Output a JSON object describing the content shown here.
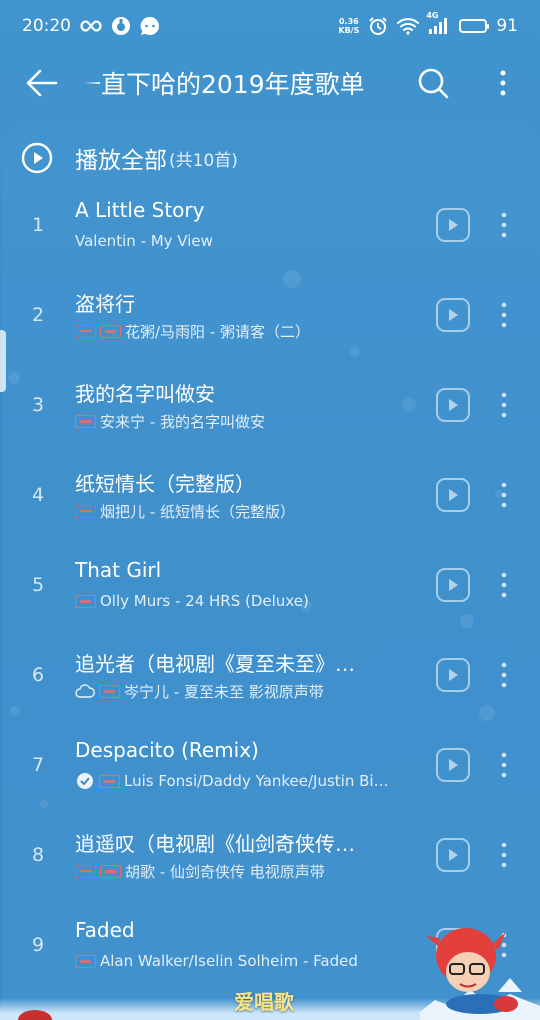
{
  "status_bar": {
    "time": "20:20",
    "net_speed_value": "0.36",
    "net_speed_unit": "KB/S",
    "network_type": "4G",
    "battery": "91"
  },
  "app_bar": {
    "title": "一直下哈的2019年度歌单"
  },
  "play_all": {
    "label": "播放全部",
    "count": "(共10首)"
  },
  "songs": [
    {
      "index": "1",
      "title": "A Little Story",
      "artist": "Valentin - My View",
      "tags": []
    },
    {
      "index": "2",
      "title": "盗将行",
      "artist": "花粥/马雨阳 - 粥请客（二）",
      "tags": [
        "vip",
        "sq"
      ]
    },
    {
      "index": "3",
      "title": "我的名字叫做安",
      "artist": "安来宁 - 我的名字叫做安",
      "tags": [
        "sq"
      ]
    },
    {
      "index": "4",
      "title": "纸短情长（完整版）",
      "artist": "烟把儿 - 纸短情长（完整版）",
      "tags": [
        "vip"
      ]
    },
    {
      "index": "5",
      "title": "That Girl",
      "artist": "Olly Murs - 24 HRS (Deluxe)",
      "tags": [
        "sq"
      ]
    },
    {
      "index": "6",
      "title": "追光者（电视剧《夏至未至》…",
      "artist": "岑宁儿 - 夏至未至 影视原声带",
      "tags": [
        "cloud",
        "sq"
      ]
    },
    {
      "index": "7",
      "title": "Despacito (Remix)",
      "artist": "Luis Fonsi/Daddy Yankee/Justin Bi…",
      "tags": [
        "check",
        "sq"
      ]
    },
    {
      "index": "8",
      "title": "逍遥叹（电视剧《仙剑奇侠传…",
      "artist": "胡歌 - 仙剑奇侠传 电视原声带",
      "tags": [
        "vip",
        "sq"
      ]
    },
    {
      "index": "9",
      "title": "Faded",
      "artist": "Alan Walker/Iselin Solheim - Faded",
      "tags": [
        "sq"
      ]
    }
  ],
  "brand": "爱唱歌",
  "icons": {
    "back": "arrow-left-icon",
    "search": "search-icon",
    "more": "more-vertical-icon",
    "play_all": "play-circle-icon",
    "row_play": "play-square-icon"
  },
  "colors": {
    "background": "#3d8fcb",
    "tag_red": "#d2746f",
    "brand_yellow": "#f7e38a"
  }
}
